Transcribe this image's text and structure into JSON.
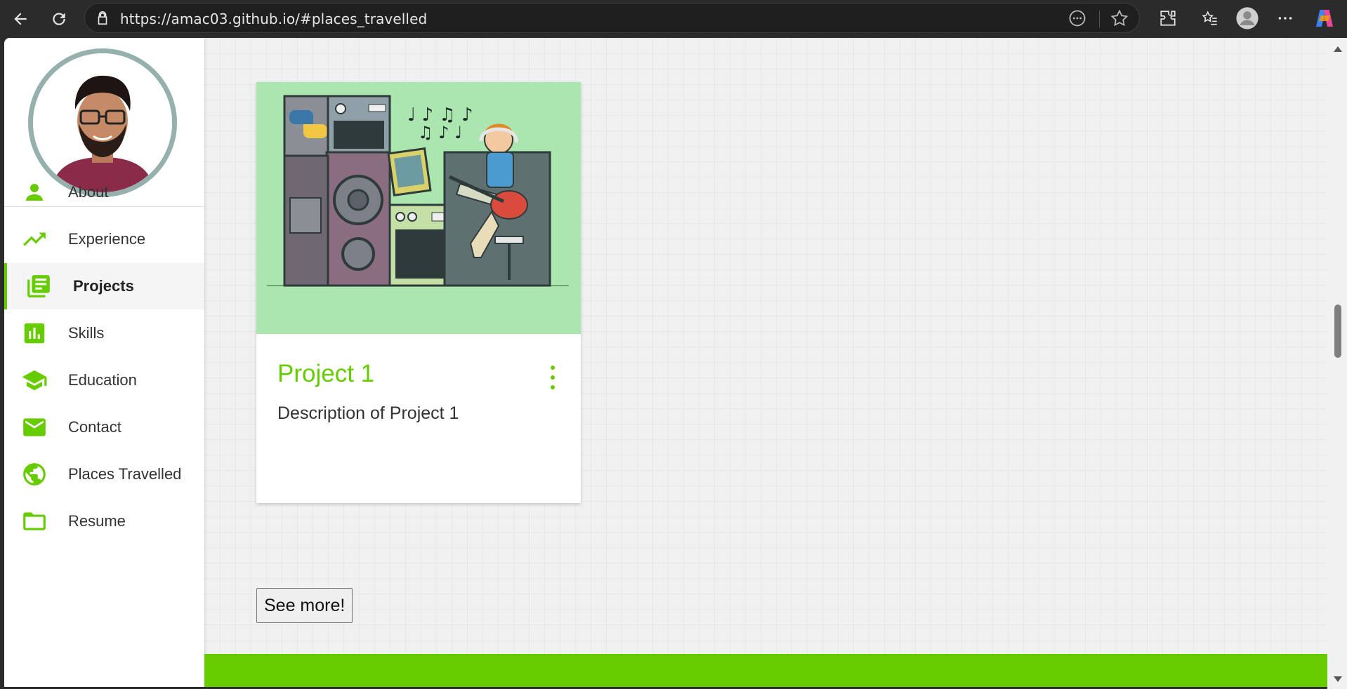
{
  "browser": {
    "url": "https://amac03.github.io/#places_travelled"
  },
  "sidebar": {
    "items": [
      {
        "label": "About",
        "icon": "person-icon"
      },
      {
        "label": "Experience",
        "icon": "trending-up-icon"
      },
      {
        "label": "Projects",
        "icon": "library-books-icon",
        "active": true
      },
      {
        "label": "Skills",
        "icon": "bar-chart-icon"
      },
      {
        "label": "Education",
        "icon": "school-icon"
      },
      {
        "label": "Contact",
        "icon": "mail-icon"
      },
      {
        "label": "Places Travelled",
        "icon": "globe-icon"
      },
      {
        "label": "Resume",
        "icon": "folder-icon"
      }
    ]
  },
  "project_card": {
    "title": "Project 1",
    "description": "Description of Project 1"
  },
  "see_more_label": "See more!",
  "colors": {
    "accent": "#66cc00",
    "card_image_bg": "#abe6af",
    "avatar_border": "#95b0ad"
  }
}
